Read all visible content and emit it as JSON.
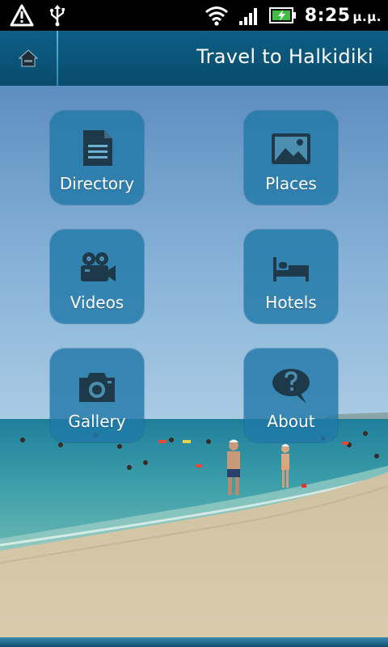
{
  "status_bar": {
    "time": "8:25",
    "ampm": "μ.μ.",
    "icons": [
      "alert-triangle-icon",
      "usb-icon",
      "wifi-icon",
      "signal-icon",
      "battery-charging-icon"
    ]
  },
  "title_bar": {
    "title": "Travel to Halkidiki",
    "home_icon": "home-icon"
  },
  "menu": {
    "tiles": [
      {
        "label": "Directory",
        "icon": "document-icon"
      },
      {
        "label": "Places",
        "icon": "picture-icon"
      },
      {
        "label": "Videos",
        "icon": "video-camera-icon"
      },
      {
        "label": "Hotels",
        "icon": "bed-icon"
      },
      {
        "label": "Gallery",
        "icon": "camera-icon"
      },
      {
        "label": "About",
        "icon": "question-bubble-icon"
      }
    ]
  },
  "colors": {
    "title_bar": "#0b5478",
    "tile": "#2179a8",
    "icon": "#1e3a4a"
  }
}
